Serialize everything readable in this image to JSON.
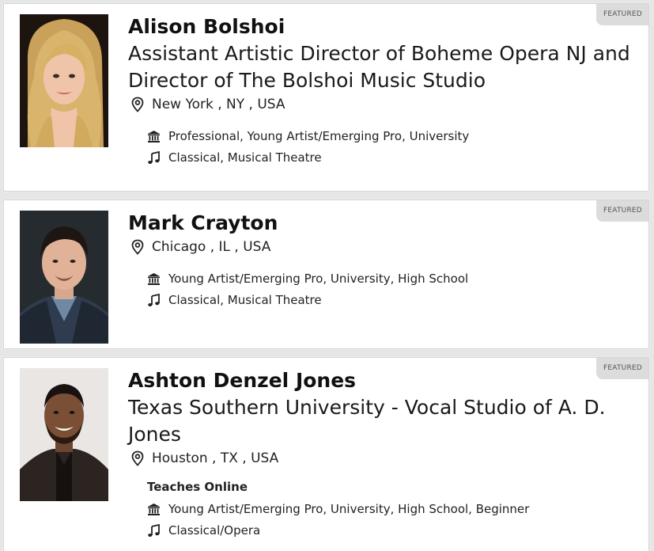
{
  "badge_label": "FEATURED",
  "teachers": [
    {
      "name": "Alison Bolshoi",
      "title": "Assistant Artistic Director of Boheme Opera NJ and Director of The Bolshoi Music Studio",
      "location": "New York , NY , USA",
      "teaches_online": "",
      "levels": "Professional, Young Artist/Emerging Pro, University",
      "genres": "Classical, Musical Theatre"
    },
    {
      "name": "Mark Crayton",
      "title": "",
      "location": "Chicago , IL , USA",
      "teaches_online": "",
      "levels": "Young Artist/Emerging Pro, University, High School",
      "genres": "Classical, Musical Theatre"
    },
    {
      "name": "Ashton Denzel Jones",
      "title": "Texas Southern University - Vocal Studio of A. D. Jones",
      "location": "Houston , TX , USA",
      "teaches_online": "Teaches Online",
      "levels": "Young Artist/Emerging Pro, University, High School, Beginner",
      "genres": "Classical/Opera"
    }
  ],
  "icons": {
    "location": "map-pin-icon",
    "levels": "institution-icon",
    "genres": "music-note-icon"
  },
  "colors": {
    "card_bg": "#ffffff",
    "page_bg": "#e6e6e6",
    "badge_bg": "#dcdcdc",
    "text": "#1a1a1a"
  }
}
